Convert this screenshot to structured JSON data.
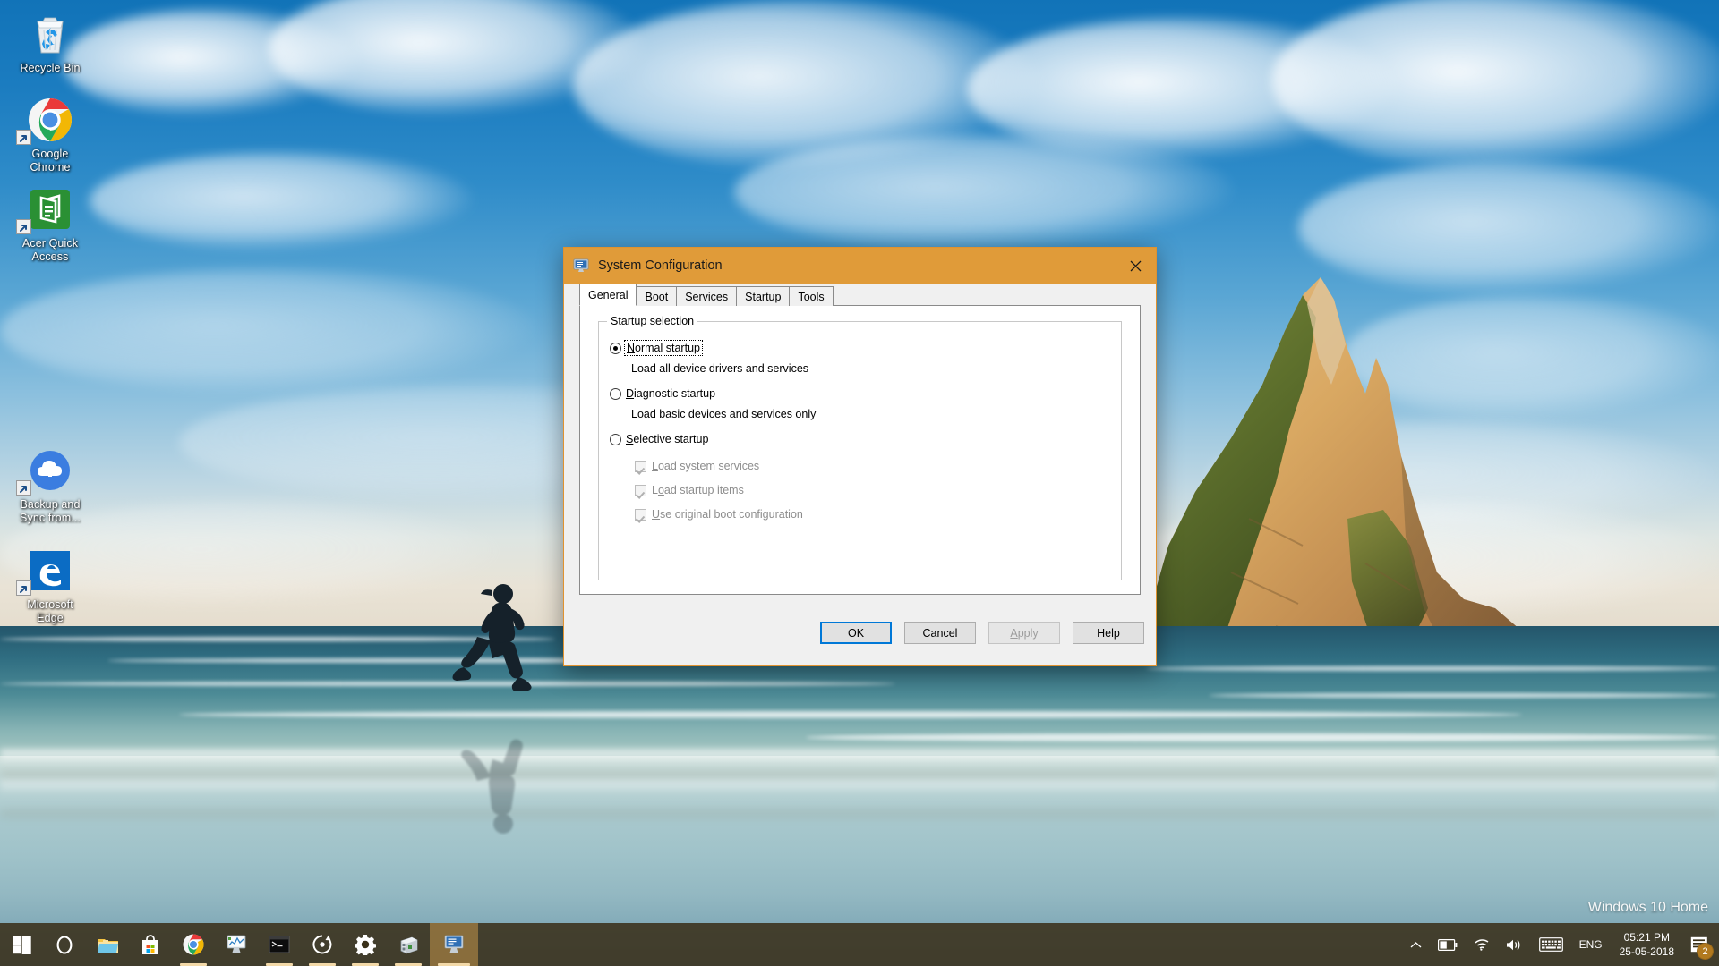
{
  "desktop": {
    "watermark": "Windows 10 Home",
    "icons": [
      {
        "label": "Recycle Bin",
        "icon": "recycle-bin-icon",
        "shortcut": false
      },
      {
        "label": "Google\nChrome",
        "icon": "google-chrome-icon",
        "shortcut": true
      },
      {
        "label": "Acer Quick\nAccess",
        "icon": "acer-quick-access-icon",
        "shortcut": true
      },
      {
        "label": "Backup and\nSync from...",
        "icon": "backup-and-sync-icon",
        "shortcut": true
      },
      {
        "label": "Microsoft\nEdge",
        "icon": "microsoft-edge-icon",
        "shortcut": true
      }
    ]
  },
  "taskbar": {
    "buttons": [
      {
        "name": "start-button",
        "icon": "windows-logo-icon",
        "running": false
      },
      {
        "name": "cortana-button",
        "icon": "cortana-circle-icon",
        "running": false
      },
      {
        "name": "file-explorer-button",
        "icon": "file-explorer-icon",
        "running": false
      },
      {
        "name": "microsoft-store-button",
        "icon": "microsoft-store-icon",
        "running": false
      },
      {
        "name": "chrome-button",
        "icon": "google-chrome-icon",
        "running": true
      },
      {
        "name": "task-manager-button",
        "icon": "task-manager-icon",
        "running": false
      },
      {
        "name": "command-prompt-button",
        "icon": "command-prompt-icon",
        "running": true
      },
      {
        "name": "recovery-button",
        "icon": "recovery-circle-icon",
        "running": true
      },
      {
        "name": "settings-button",
        "icon": "gear-icon",
        "running": true
      },
      {
        "name": "device-manager-button",
        "icon": "device-manager-icon",
        "running": true
      },
      {
        "name": "system-configuration-button",
        "icon": "system-configuration-icon",
        "running": true,
        "active": true
      }
    ],
    "tray": {
      "show_hidden": "show-hidden-icons-chevron",
      "battery": "battery-icon",
      "network": "wifi-icon",
      "volume": "speaker-icon",
      "input": "keyboard-icon",
      "language": "ENG",
      "time": "05:21 PM",
      "date": "25-05-2018",
      "action_center_badge": "2"
    }
  },
  "dialog": {
    "title": "System Configuration",
    "title_icon": "system-configuration-icon",
    "close_label": "✕",
    "tabs": [
      {
        "label": "General",
        "active": true
      },
      {
        "label": "Boot",
        "active": false
      },
      {
        "label": "Services",
        "active": false
      },
      {
        "label": "Startup",
        "active": false
      },
      {
        "label": "Tools",
        "active": false
      }
    ],
    "group": {
      "legend": "Startup selection",
      "options": [
        {
          "label": "Normal startup",
          "accel": "N",
          "selected": true,
          "focused": true,
          "description": "Load all device drivers and services"
        },
        {
          "label": "Diagnostic startup",
          "accel": "D",
          "selected": false,
          "focused": false,
          "description": "Load basic devices and services only"
        },
        {
          "label": "Selective startup",
          "accel": "S",
          "selected": false,
          "focused": false,
          "description": ""
        }
      ],
      "checkboxes": [
        {
          "label": "Load system services",
          "accel": "L",
          "checked": true,
          "disabled": true
        },
        {
          "label": "Load startup items",
          "accel": "o",
          "checked": true,
          "disabled": true
        },
        {
          "label": "Use original boot configuration",
          "accel": "U",
          "checked": true,
          "disabled": true
        }
      ]
    },
    "buttons": [
      {
        "label": "OK",
        "state": "default"
      },
      {
        "label": "Cancel",
        "state": "normal"
      },
      {
        "label": "Apply",
        "state": "disabled"
      },
      {
        "label": "Help",
        "state": "normal"
      }
    ]
  },
  "colors": {
    "titlebar": "#e09b39",
    "dialog_bg": "#f0f0f0",
    "focus_blue": "#0078d7",
    "taskbar": "rgba(58,48,26,.88)",
    "badge": "#b1791f"
  }
}
